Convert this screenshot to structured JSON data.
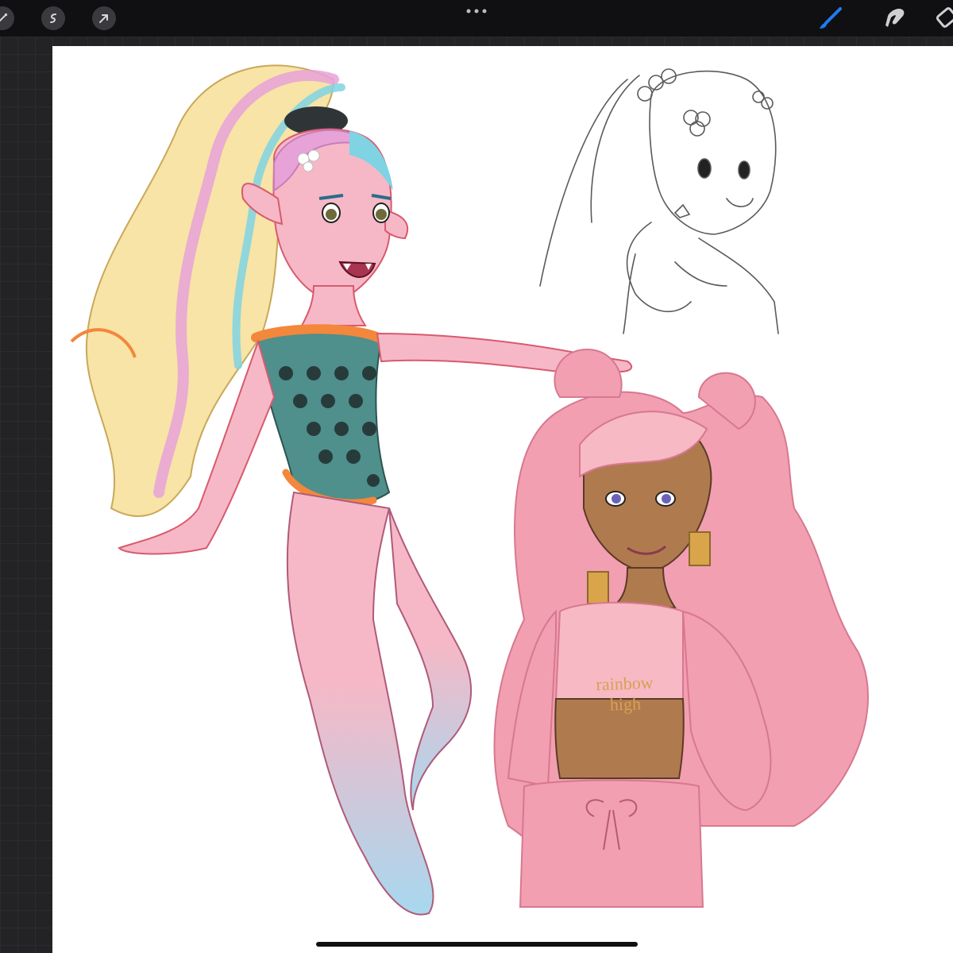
{
  "app": {
    "toolbar_left": [
      {
        "icon": "adjustments-wand-icon"
      },
      {
        "icon": "selection-icon"
      },
      {
        "icon": "transform-arrow-icon"
      }
    ],
    "toolbar_center": {
      "icon": "more-dots-icon"
    },
    "toolbar_right": [
      {
        "icon": "brush-icon",
        "active": true,
        "color": "#1e7bf5"
      },
      {
        "icon": "smudge-icon",
        "active": false
      },
      {
        "icon": "eraser-icon",
        "active": false
      }
    ]
  },
  "canvas": {
    "background": "#ffffff",
    "artwork": [
      {
        "name": "mermaid-girl",
        "palette": [
          "#f6b8c6",
          "#f7e4a6",
          "#7fd3e3",
          "#e7a2d8",
          "#4f8f8c",
          "#f3873c",
          "#a7d8ef"
        ]
      },
      {
        "name": "sketch-portrait",
        "palette": [
          "#555555"
        ]
      },
      {
        "name": "pink-hoodie-girl",
        "palette": [
          "#f29fb1",
          "#b07a4f",
          "#f7b9c3",
          "#d9a44a"
        ]
      }
    ],
    "shirt_text": "rainbow high"
  },
  "colors": {
    "toolbar": "#101012",
    "workspace": "#232326",
    "accent": "#1e7bf5"
  }
}
